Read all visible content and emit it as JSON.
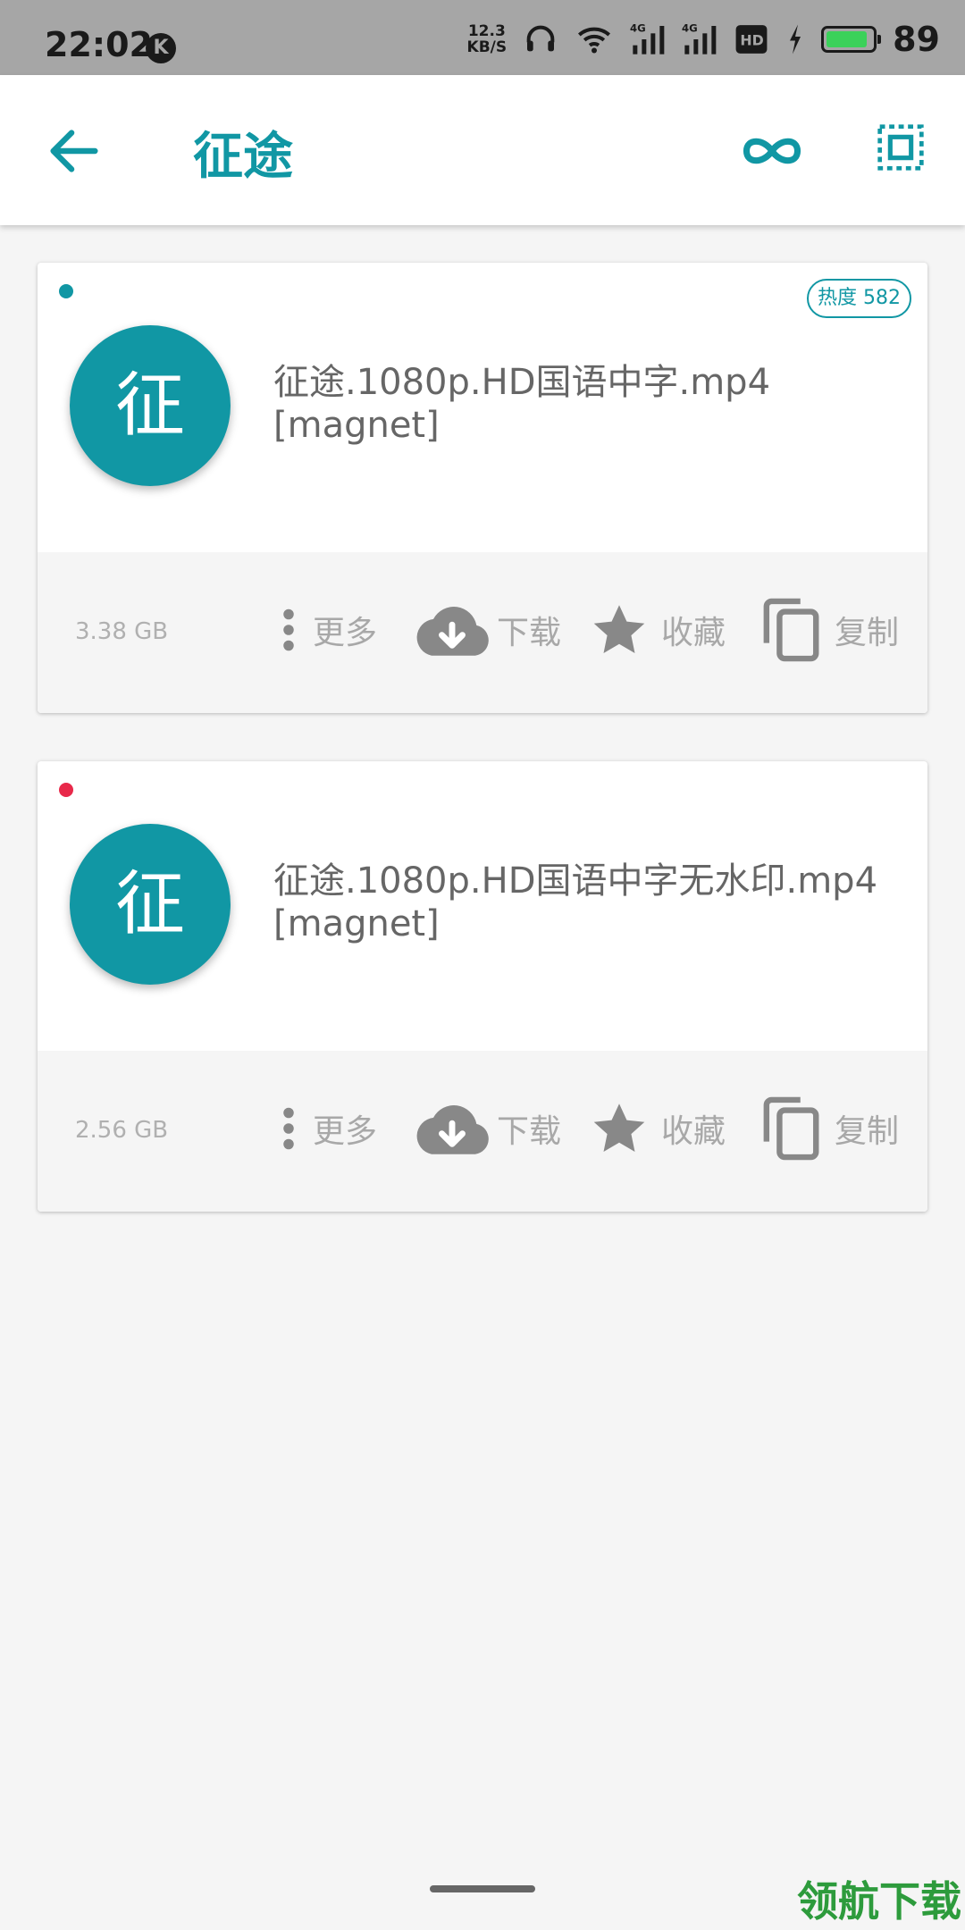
{
  "status_bar": {
    "time": "22:02",
    "net_speed_value": "12.3",
    "net_speed_unit": "KB/S",
    "battery_pct": "89"
  },
  "app_bar": {
    "title": "征途",
    "accent_color": "#1197a4"
  },
  "results": [
    {
      "dot_color": "#1197a4",
      "hot_label": "热度 582",
      "avatar_char": "征",
      "name": "征途.1080p.HD国语中字.mp4 [magnet]",
      "size": "3.38 GB",
      "actions": {
        "more": "更多",
        "download": "下载",
        "favorite": "收藏",
        "copy": "复制"
      }
    },
    {
      "dot_color": "#e8294a",
      "hot_label": "",
      "avatar_char": "征",
      "name": "征途.1080p.HD国语中字无水印.mp4 [magnet]",
      "size": "2.56 GB",
      "actions": {
        "more": "更多",
        "download": "下载",
        "favorite": "收藏",
        "copy": "复制"
      }
    }
  ],
  "watermark": "领航下载"
}
